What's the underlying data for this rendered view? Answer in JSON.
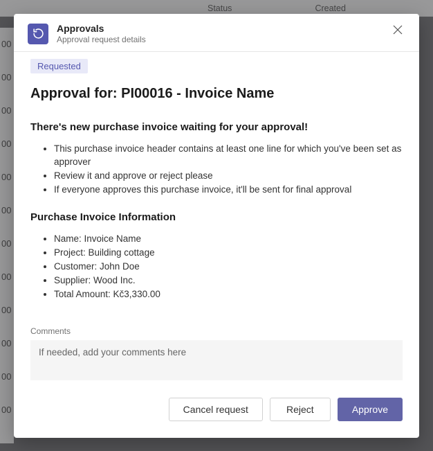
{
  "background": {
    "col1": "Status",
    "col2": "Created",
    "rowNums": [
      "00",
      "00",
      "00",
      "00",
      "00",
      "00",
      "00",
      "00",
      "00",
      "00",
      "00",
      "00"
    ]
  },
  "header": {
    "title": "Approvals",
    "subtitle": "Approval request details"
  },
  "status": "Requested",
  "approval_title": "Approval for: PI00016 - Invoice Name",
  "intro_heading": "There's new purchase invoice waiting for your approval!",
  "intro_bullets": [
    "This purchase invoice header contains at least one line for which you've been set as approver",
    "Review it and approve or reject please",
    "If everyone approves this purchase invoice, it'll be sent for final approval"
  ],
  "info_heading": "Purchase Invoice Information",
  "info_bullets": [
    "Name: Invoice Name",
    "Project: Building cottage",
    "Customer: John Doe",
    "Supplier: Wood Inc.",
    "Total Amount: Kč3,330.00"
  ],
  "comments": {
    "label": "Comments",
    "placeholder": "If needed, add your comments here"
  },
  "buttons": {
    "cancel": "Cancel request",
    "reject": "Reject",
    "approve": "Approve"
  }
}
